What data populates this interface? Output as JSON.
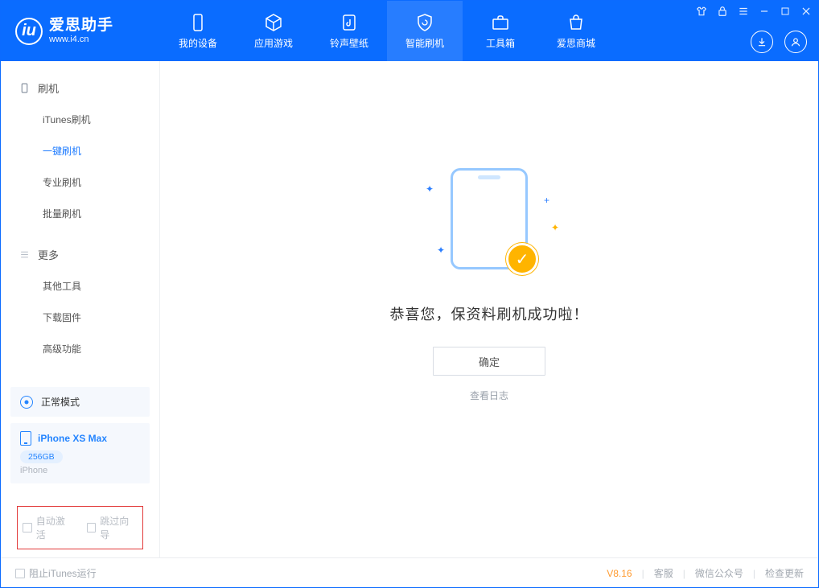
{
  "header": {
    "app_name": "爱思助手",
    "app_url": "www.i4.cn",
    "tabs": [
      {
        "label": "我的设备"
      },
      {
        "label": "应用游戏"
      },
      {
        "label": "铃声壁纸"
      },
      {
        "label": "智能刷机"
      },
      {
        "label": "工具箱"
      },
      {
        "label": "爱思商城"
      }
    ]
  },
  "sidebar": {
    "group1_title": "刷机",
    "group1_items": [
      {
        "label": "iTunes刷机"
      },
      {
        "label": "一键刷机"
      },
      {
        "label": "专业刷机"
      },
      {
        "label": "批量刷机"
      }
    ],
    "group2_title": "更多",
    "group2_items": [
      {
        "label": "其他工具"
      },
      {
        "label": "下载固件"
      },
      {
        "label": "高级功能"
      }
    ],
    "mode_label": "正常模式",
    "device_name": "iPhone XS Max",
    "device_capacity": "256GB",
    "device_type": "iPhone",
    "chk_auto_activate": "自动激活",
    "chk_skip_guide": "跳过向导"
  },
  "main": {
    "success_message": "恭喜您，保资料刷机成功啦！",
    "ok_button": "确定",
    "view_log": "查看日志"
  },
  "footer": {
    "block_itunes": "阻止iTunes运行",
    "version": "V8.16",
    "link_service": "客服",
    "link_wechat": "微信公众号",
    "link_update": "检查更新"
  }
}
